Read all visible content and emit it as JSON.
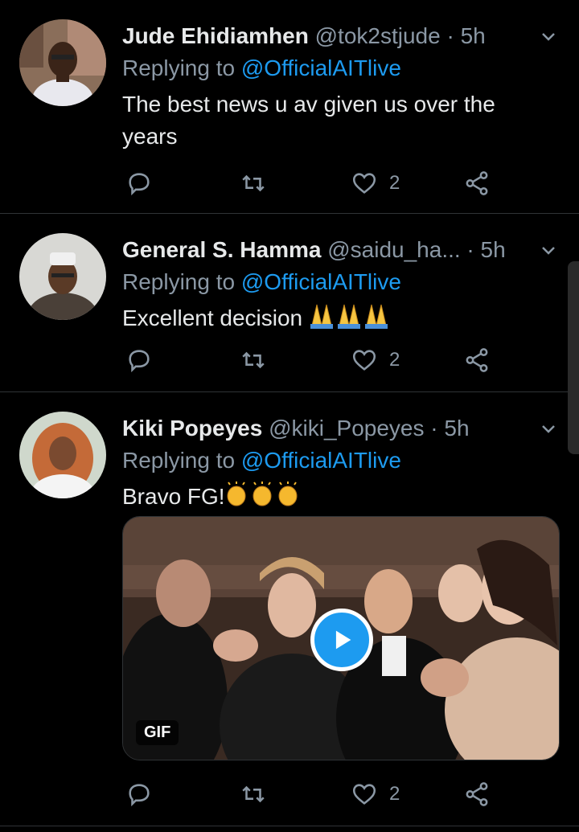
{
  "tweets": [
    {
      "name": "Jude Ehidiamhen",
      "handle": "@tok2stjude",
      "time": "5h",
      "replying_prefix": "Replying to ",
      "replying_to": "@OfficialAITlive",
      "body": "The best news u av given us over the years",
      "likes": "2"
    },
    {
      "name": "General S. Hamma",
      "handle": "@saidu_ha...",
      "time": "5h",
      "replying_prefix": "Replying to ",
      "replying_to": "@OfficialAITlive",
      "body": "Excellent decision ",
      "likes": "2"
    },
    {
      "name": "Kiki Popeyes",
      "handle": "@kiki_Popeyes",
      "time": "5h",
      "replying_prefix": "Replying to ",
      "replying_to": "@OfficialAITlive",
      "body": "Bravo FG!",
      "likes": "2",
      "media_badge": "GIF"
    }
  ],
  "separator": " · ",
  "colors": {
    "accent": "#1d9bf0",
    "muted": "#8b98a5",
    "background": "#000000"
  },
  "icons": [
    "reply-icon",
    "retweet-icon",
    "like-icon",
    "share-icon",
    "chevron-down-icon",
    "praying-hands-emoji",
    "clapping-hands-emoji",
    "play-icon"
  ]
}
